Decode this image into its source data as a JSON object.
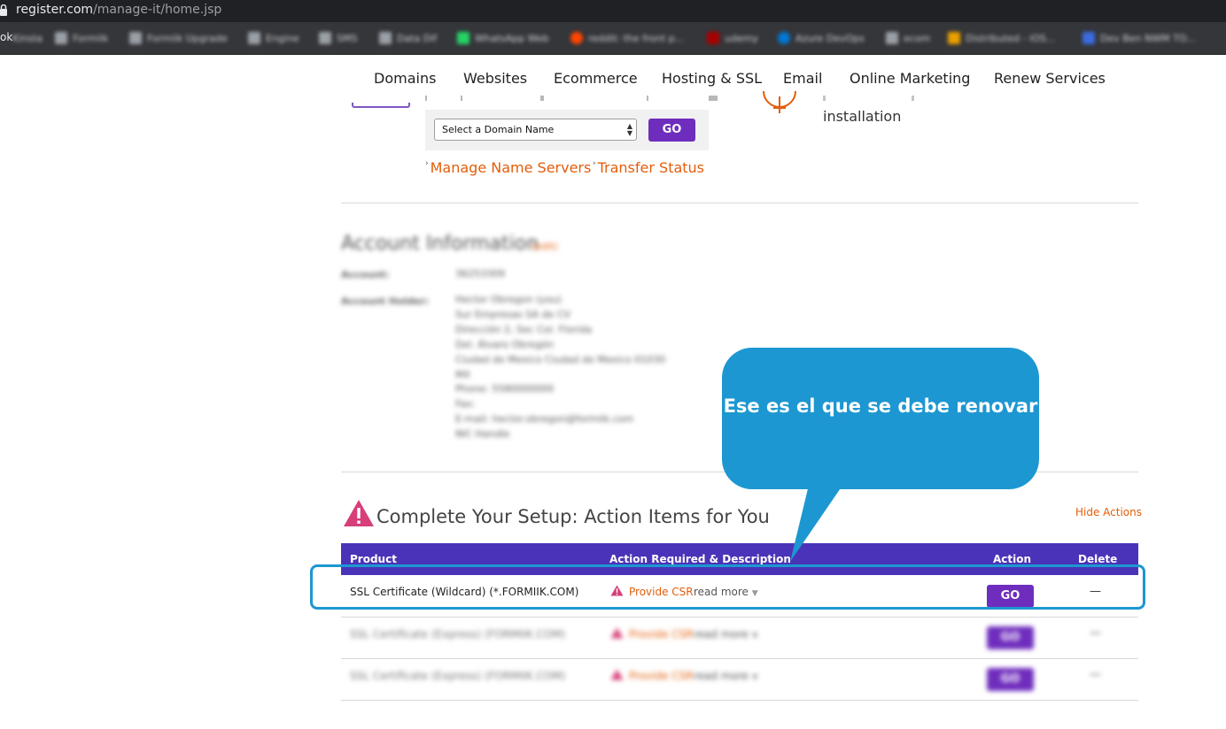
{
  "browser": {
    "url_host": "register.com",
    "url_path": "/manage-it/home.jsp",
    "bookmarks_partial_label": "ok",
    "bookmarks": [
      "Kinsta",
      "Formiik",
      "Formiik Upgrade",
      "Engine",
      "SMS",
      "Data Dif",
      "WhatsApp Web",
      "reddit: the front p...",
      "udemy",
      "Azure DevOps",
      "ecom",
      "Distributed - iOS...",
      "Dev Ben NWM TO..."
    ]
  },
  "nav": {
    "items": [
      "Domains",
      "Websites",
      "Ecommerce",
      "Hosting & SSL",
      "Email",
      "Online Marketing",
      "Renew Services"
    ]
  },
  "domain_tools": {
    "select_placeholder": "Select a Domain Name",
    "go_label": "GO",
    "links": [
      "Manage Name Servers",
      "Transfer Status"
    ],
    "installation_text": "installation"
  },
  "account": {
    "title": "Account Information",
    "edit_label": "(edit)",
    "account_label": "Account:",
    "account_value": "36253309",
    "holder_label": "Account Holder:",
    "holder_lines": [
      "Hector Obregon (you)",
      "Sur Empresas SA de CV",
      "Dirección 2, Sec Col. Florida",
      "Del. Álvaro Obregón",
      "Ciudad de Mexico Ciudad de Mexico 01030",
      "MX",
      "Phone: 5580000000",
      "Fax:",
      "E-mail: hector.obregon@formiik.com",
      "NIC Handle"
    ]
  },
  "callout": {
    "text": "Ese es el que se debe renovar"
  },
  "setup": {
    "title": "Complete Your Setup: Action Items for You",
    "hide_actions": "Hide Actions",
    "columns": {
      "product": "Product",
      "action_required": "Action Required & Description",
      "action": "Action",
      "delete": "Delete"
    },
    "rows": [
      {
        "product": "SSL Certificate (Wildcard) (*.FORMIIK.COM)",
        "provide": "Provide CSR",
        "read_more": "read more",
        "go": "GO",
        "delete": "—"
      },
      {
        "product": "SSL Certificate (Express) (FORMIIK.COM)",
        "provide": "Provide CSR",
        "read_more": "read more",
        "go": "GO",
        "delete": "—"
      },
      {
        "product": "SSL Certificate (Express) (FORMIIK.COM)",
        "provide": "Provide CSR",
        "read_more": "read more",
        "go": "GO",
        "delete": "—"
      }
    ]
  },
  "colors": {
    "purple_button": "#6f2dbd",
    "table_header": "#4a33b8",
    "orange_link": "#e35d0a",
    "callout_blue": "#1d97d1",
    "warning_pink": "#d63f7a"
  }
}
